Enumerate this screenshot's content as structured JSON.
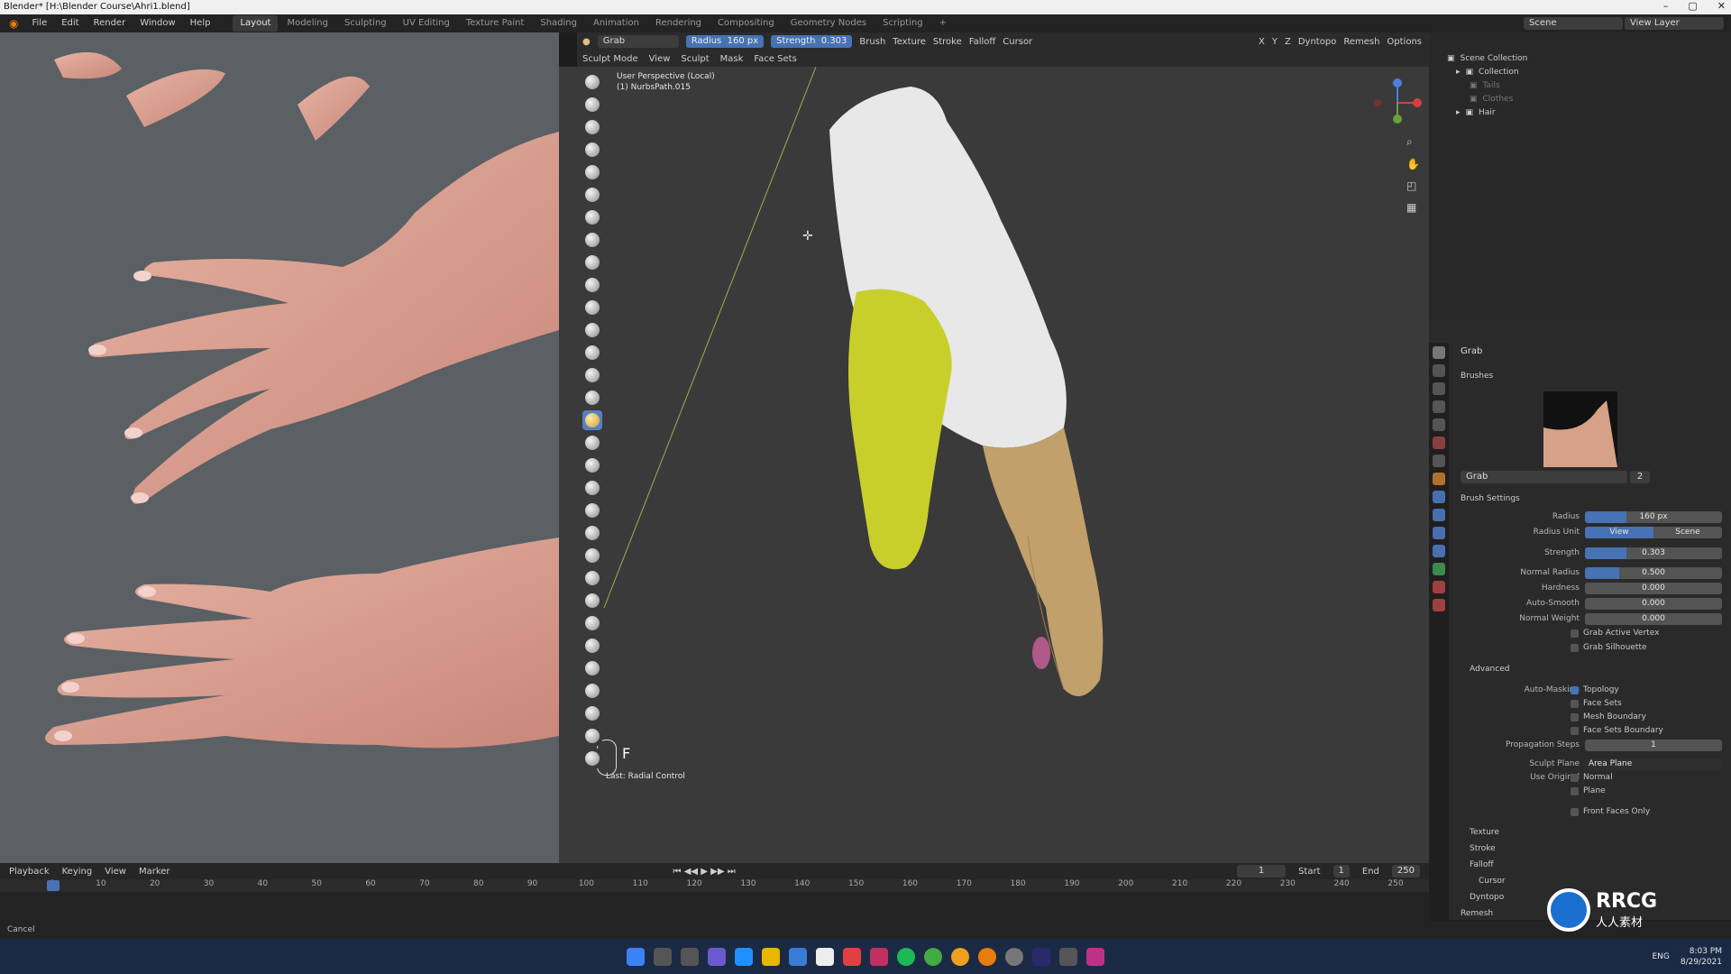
{
  "window": {
    "title": "Blender* [H:\\Blender Course\\Ahri1.blend]",
    "min": "–",
    "max": "▢",
    "close": "✕"
  },
  "menu": {
    "items": [
      "File",
      "Edit",
      "Render",
      "Window",
      "Help"
    ],
    "tabs": [
      "Layout",
      "Modeling",
      "Sculpting",
      "UV Editing",
      "Texture Paint",
      "Shading",
      "Animation",
      "Rendering",
      "Compositing",
      "Geometry Nodes",
      "Scripting"
    ],
    "active_tab": "Layout",
    "add_tab": "+"
  },
  "scene": {
    "label": "Scene",
    "view_layer": "View Layer"
  },
  "tool_header": {
    "brush_name": "Grab",
    "radius_label": "Radius",
    "radius_value": "160 px",
    "strength_label": "Strength",
    "strength_value": "0.303",
    "menus": [
      "Brush",
      "Texture",
      "Stroke",
      "Falloff",
      "Cursor"
    ],
    "axes": [
      "X",
      "Y",
      "Z"
    ],
    "dyntopo": "Dyntopo",
    "remesh": "Remesh",
    "options": "Options"
  },
  "mode_header": {
    "mode": "Sculpt Mode",
    "menus": [
      "View",
      "Sculpt",
      "Mask",
      "Face Sets"
    ]
  },
  "viewport": {
    "perspective": "User Perspective (Local)",
    "object": "(1) NurbsPath.015",
    "last_op": "Last: Radial Control",
    "key_hint": "F"
  },
  "outliner": {
    "root": "Scene Collection",
    "items": [
      {
        "name": "Collection",
        "dim": false
      },
      {
        "name": "Tails",
        "dim": true
      },
      {
        "name": "Clothes",
        "dim": true
      },
      {
        "name": "Hair",
        "dim": false
      }
    ]
  },
  "properties": {
    "brush_header": "Grab",
    "brushes_section": "Brushes",
    "brush_slot": "Grab",
    "brush_users": "2",
    "brush_settings": "Brush Settings",
    "radius": {
      "label": "Radius",
      "value": "160 px",
      "fill": 0.3
    },
    "radius_unit": {
      "label": "Radius Unit",
      "options": [
        "View",
        "Scene"
      ],
      "selected": "View"
    },
    "strength": {
      "label": "Strength",
      "value": "0.303",
      "fill": 0.3
    },
    "normal_radius": {
      "label": "Normal Radius",
      "value": "0.500",
      "fill": 0.25
    },
    "hardness": {
      "label": "Hardness",
      "value": "0.000",
      "fill": 0
    },
    "auto_smooth": {
      "label": "Auto-Smooth",
      "value": "0.000",
      "fill": 0
    },
    "normal_weight": {
      "label": "Normal Weight",
      "value": "0.000",
      "fill": 0
    },
    "grab_active_vertex": "Grab Active Vertex",
    "grab_silhouette": "Grab Silhouette",
    "advanced": "Advanced",
    "auto_masking": "Auto-Masking",
    "topology": "Topology",
    "face_sets": "Face Sets",
    "mesh_boundary": "Mesh Boundary",
    "face_sets_boundary": "Face Sets Boundary",
    "propagation_steps": {
      "label": "Propagation Steps",
      "value": "1"
    },
    "sculpt_plane": {
      "label": "Sculpt Plane",
      "value": "Area Plane"
    },
    "use_original": "Use Original",
    "normal": "Normal",
    "plane": "Plane",
    "front_faces_only": "Front Faces Only",
    "subsections": [
      "Texture",
      "Stroke",
      "Falloff",
      "Cursor"
    ],
    "dyntopo": "Dyntopo",
    "remesh": "Remesh"
  },
  "timeline": {
    "menus": [
      "Playback",
      "Keying",
      "View",
      "Marker"
    ],
    "current_frame": "1",
    "start_label": "Start",
    "start": "1",
    "end_label": "End",
    "end": "250",
    "ticks": [
      "1",
      "10",
      "20",
      "30",
      "40",
      "50",
      "60",
      "70",
      "80",
      "90",
      "100",
      "110",
      "120",
      "130",
      "140",
      "150",
      "160",
      "170",
      "180",
      "190",
      "200",
      "210",
      "220",
      "230",
      "240",
      "250"
    ]
  },
  "status": {
    "text": "Cancel"
  },
  "tray": {
    "lang": "ENG",
    "time": "8:03 PM",
    "date": "8/29/2021"
  },
  "watermark": {
    "brand": "RRCG",
    "subtitle": "人人素材"
  }
}
